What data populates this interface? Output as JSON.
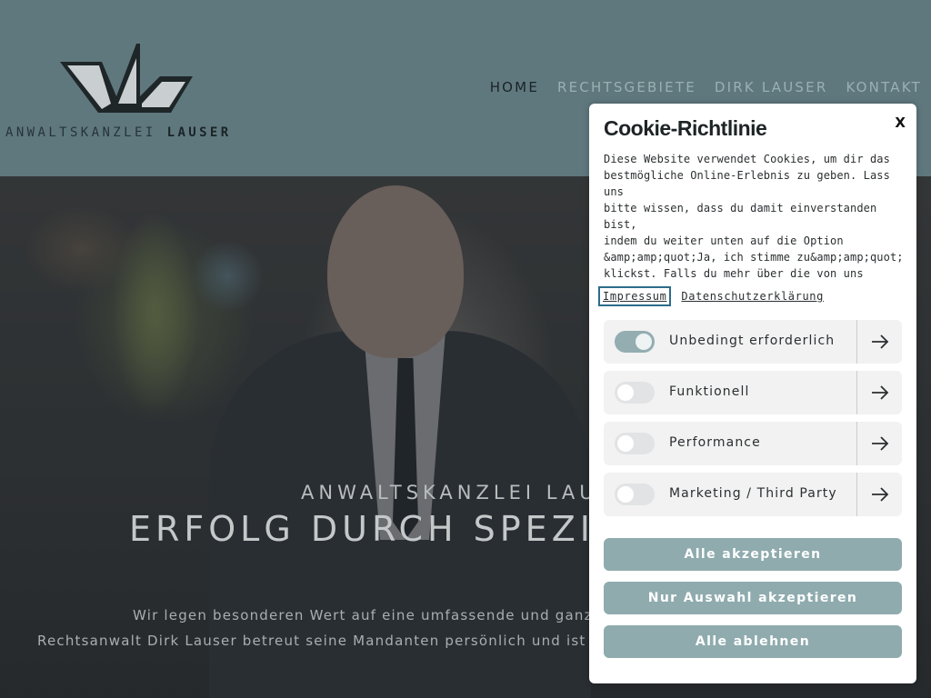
{
  "brand": {
    "logo_word1": "ANWALTSKANZLEI",
    "logo_word2": "LAUSER"
  },
  "nav": {
    "items": [
      {
        "label": "HOME",
        "active": true
      },
      {
        "label": "RECHTSGEBIETE",
        "active": false
      },
      {
        "label": "DIRK LAUSER",
        "active": false
      },
      {
        "label": "KONTAKT",
        "active": false
      }
    ]
  },
  "hero": {
    "subtitle": "ANWALTSKANZLEI LAUSER",
    "title": "ERFOLG DURCH SPEZIALISIERUNG",
    "line1": "Wir legen besonderen Wert auf eine umfassende und ganzheitliche",
    "line2": "Rechtsanwalt Dirk Lauser betreut seine Mandanten persönlich und ist für die"
  },
  "cookie": {
    "title": "Cookie-Richtlinie",
    "close_label": "X",
    "text": "Diese Website verwendet Cookies, um dir das\nbestmögliche Online-Erlebnis zu geben. Lass uns\nbitte wissen, dass du damit einverstanden bist,\nindem du weiter unten auf die Option\n&amp;amp;quot;Ja, ich stimme zu&amp;amp;quot;\nklickst. Falls du mehr über die von uns\nverwendeten Cookies herausfinden und eigene\nCookie-Einstellungen verwenden möchtest, schau",
    "link_impressum": "Impressum",
    "link_datenschutz": "Datenschutzerklärung",
    "categories": [
      {
        "label": "Unbedingt erforderlich",
        "enabled": true
      },
      {
        "label": "Funktionell",
        "enabled": false
      },
      {
        "label": "Performance",
        "enabled": false
      },
      {
        "label": "Marketing / Third Party",
        "enabled": false
      }
    ],
    "btn_accept_all": "Alle akzeptieren",
    "btn_accept_selection": "Nur Auswahl akzeptieren",
    "btn_reject_all": "Alle ablehnen"
  },
  "colors": {
    "header_bg": "#5f787e",
    "accent": "#8fabae",
    "nav_active": "#1b2326",
    "nav_inactive": "#9ab0b3"
  },
  "icons": {
    "category_arrow": "arrow-right-icon",
    "logo": "lauser-logo-icon"
  }
}
